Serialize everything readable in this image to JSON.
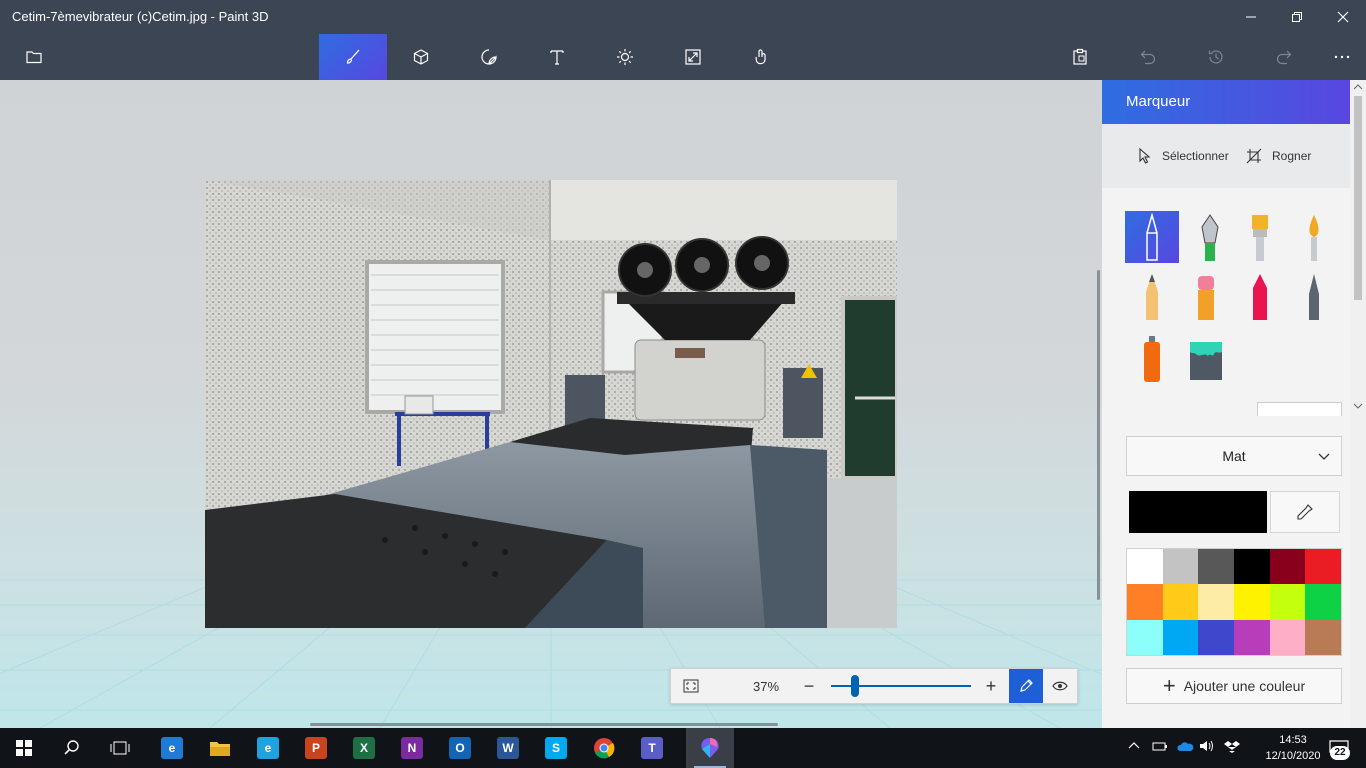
{
  "window": {
    "title": "Cetim-7èmevibrateur (c)Cetim.jpg - Paint 3D",
    "minimize_icon": "minimize-icon",
    "restore_icon": "restore-icon",
    "close_icon": "close-icon"
  },
  "toolbar": {
    "items": [
      {
        "name": "menu",
        "icon": "folder-icon"
      },
      {
        "name": "brushes",
        "icon": "brush-icon",
        "active": true
      },
      {
        "name": "3d-shapes",
        "icon": "cube-icon"
      },
      {
        "name": "stickers",
        "icon": "sticker-icon"
      },
      {
        "name": "text",
        "icon": "text-icon"
      },
      {
        "name": "effects",
        "icon": "sun-icon"
      },
      {
        "name": "canvas",
        "icon": "resize-icon"
      },
      {
        "name": "3d-library",
        "icon": "library-icon"
      },
      {
        "name": "paste",
        "icon": "paste-icon"
      },
      {
        "name": "undo",
        "icon": "undo-icon",
        "enabled": false
      },
      {
        "name": "history",
        "icon": "history-icon",
        "enabled": false
      },
      {
        "name": "redo",
        "icon": "redo-icon",
        "enabled": false
      },
      {
        "name": "more",
        "icon": "more-icon"
      }
    ]
  },
  "panel": {
    "title": "Marqueur",
    "select_label": "Sélectionner",
    "crop_label": "Rogner",
    "brushes": [
      {
        "name": "marker",
        "selected": true
      },
      {
        "name": "calligraphy-pen"
      },
      {
        "name": "oil-brush"
      },
      {
        "name": "watercolor"
      },
      {
        "name": "pencil"
      },
      {
        "name": "eraser"
      },
      {
        "name": "crayon"
      },
      {
        "name": "pixel-pen"
      },
      {
        "name": "spray-can"
      },
      {
        "name": "fill"
      }
    ],
    "finish": "Mat",
    "current_color": "#000000",
    "palette": [
      "#ffffff",
      "#c3c3c3",
      "#585858",
      "#000000",
      "#88001b",
      "#ec1c24",
      "#ff7f27",
      "#ffca18",
      "#fdeca6",
      "#fff200",
      "#c4ff0e",
      "#0ed145",
      "#8cfffb",
      "#00a8f3",
      "#3f48cc",
      "#b83dba",
      "#ffaec8",
      "#b97a56"
    ],
    "add_color_label": "Ajouter une couleur"
  },
  "zoom": {
    "value_label": "37%",
    "slider_fraction": 0.17,
    "minus": "−",
    "plus": "+"
  },
  "taskbar": {
    "apps": [
      {
        "name": "start",
        "icon": "windows-icon"
      },
      {
        "name": "search",
        "icon": "search-icon"
      },
      {
        "name": "task-view",
        "icon": "task-view-icon"
      },
      {
        "name": "edge",
        "icon": "edge-icon",
        "letter": "e",
        "color": "#1e7bd6"
      },
      {
        "name": "file-explorer",
        "icon": "folder-icon",
        "color": "#f5c342"
      },
      {
        "name": "internet-explorer",
        "icon": "ie-icon",
        "letter": "e",
        "color": "#1ea2e0"
      },
      {
        "name": "powerpoint",
        "icon": "powerpoint-icon",
        "letter": "P",
        "color": "#c8441f"
      },
      {
        "name": "excel",
        "icon": "excel-icon",
        "letter": "X",
        "color": "#1d7044"
      },
      {
        "name": "onenote",
        "icon": "onenote-icon",
        "letter": "N",
        "color": "#7a2b9e"
      },
      {
        "name": "outlook",
        "icon": "outlook-icon",
        "letter": "O",
        "color": "#1464b4"
      },
      {
        "name": "word",
        "icon": "word-icon",
        "letter": "W",
        "color": "#2b5797"
      },
      {
        "name": "skype",
        "icon": "skype-icon",
        "letter": "S",
        "color": "#00a9f0"
      },
      {
        "name": "chrome",
        "icon": "chrome-icon",
        "color": "#db4437"
      },
      {
        "name": "teams",
        "icon": "teams-icon",
        "letter": "T",
        "color": "#5a5fc8"
      },
      {
        "name": "paint-3d",
        "icon": "paint3d-icon",
        "active": true
      }
    ],
    "time": "14:53",
    "date": "12/10/2020",
    "notifications": "22"
  }
}
